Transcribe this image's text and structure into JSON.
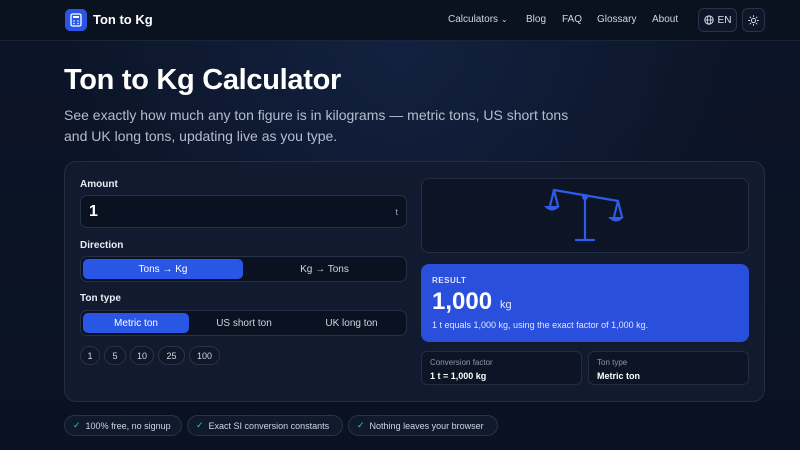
{
  "header": {
    "brand": "Ton to Kg",
    "nav": [
      {
        "label": "Calculators"
      },
      {
        "label": "Blog"
      },
      {
        "label": "FAQ"
      },
      {
        "label": "Glossary"
      },
      {
        "label": "About"
      }
    ],
    "language": "EN"
  },
  "hero": {
    "title": "Ton to Kg Calculator",
    "subtitle": "See exactly how much any ton figure is in kilograms — metric tons, US short tons and UK long tons, updating live as you type."
  },
  "form": {
    "amount_label": "Amount",
    "amount_value": "1",
    "amount_unit": "t",
    "direction_label": "Direction",
    "direction_options": [
      "Tons → Kg",
      "Kg → Tons"
    ],
    "ton_type_label": "Ton type",
    "ton_type_options": [
      "Metric ton",
      "US short ton",
      "UK long ton"
    ],
    "presets": [
      "1",
      "5",
      "10",
      "25",
      "100"
    ]
  },
  "result": {
    "label": "RESULT",
    "value": "1,000",
    "unit": "kg",
    "note": "1 t equals 1,000 kg, using the exact factor of 1,000 kg."
  },
  "details": {
    "factor_label": "Conversion factor",
    "factor_value": "1 t = 1,000 kg",
    "type_label": "Ton type",
    "type_value": "Metric ton"
  },
  "badges": [
    "100% free, no signup",
    "Exact SI conversion constants",
    "Nothing leaves your browser"
  ],
  "colors": {
    "accent": "#2a56e6",
    "result_bg": "#2a4fdc",
    "check": "#3ec7a5"
  }
}
